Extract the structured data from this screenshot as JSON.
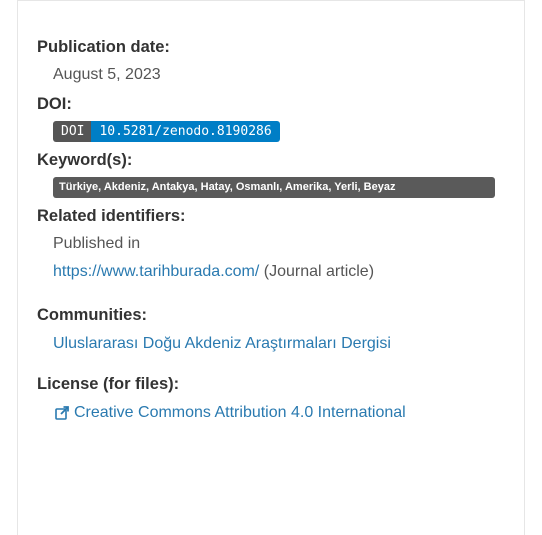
{
  "publication_date": {
    "heading": "Publication date:",
    "value": "August 5, 2023"
  },
  "doi": {
    "heading": "DOI:",
    "badge_label": "DOI",
    "badge_value": "10.5281/zenodo.8190286",
    "label_color": "#555555",
    "value_color": "#007ec6"
  },
  "keywords": {
    "heading": "Keyword(s):",
    "value": "Türkiye, Akdeniz, Antakya, Hatay, Osmanlı, Amerika, Yerli, Beyaz"
  },
  "related": {
    "heading": "Related identifiers:",
    "prefix": "Published in",
    "link_text": "https://www.tarihburada.com/",
    "suffix": "(Journal article)"
  },
  "communities": {
    "heading": "Communities:",
    "item": "Uluslararası Doğu Akdeniz Araştırmaları Dergisi"
  },
  "license": {
    "heading": "License (for files):",
    "link_text": "Creative Commons Attribution 4.0 International",
    "icon": "external-link-icon"
  },
  "colors": {
    "link": "#2a7ab0",
    "text": "#333333"
  }
}
